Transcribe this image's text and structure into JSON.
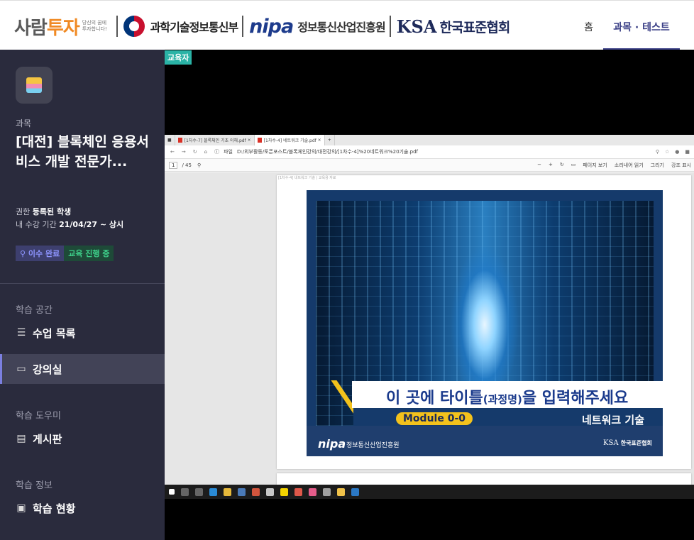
{
  "header": {
    "logo_saram_a": "사람",
    "logo_saram_b": "투자",
    "logo_saram_sub": "당신의 꿈에 투자합니다!",
    "msit": "과학기술정보통신부",
    "nipa_mark": "nipa",
    "nipa_text": "정보통신산업진흥원",
    "ksa_mark": "KSA",
    "ksa_text": "한국표준협회",
    "nav": {
      "home": "홈",
      "courses": "과목 · 테스트"
    }
  },
  "sidebar": {
    "kicker": "과목",
    "course_title": "[대전] 블록체인 응용서비스 개발 전문가...",
    "role_label": "권한",
    "role_value": "등록된 학생",
    "period_label": "내 수강 기간",
    "period_value": "21/04/27 ~ 상시",
    "badge_done": "이수 완료",
    "badge_progress": "교육 진행 중",
    "sections": [
      {
        "title": "학습 공간",
        "items": [
          {
            "label": "수업 목록",
            "icon": "list-icon"
          },
          {
            "label": "강의실",
            "icon": "monitor-icon",
            "active": true
          }
        ]
      },
      {
        "title": "학습 도우미",
        "items": [
          {
            "label": "게시판",
            "icon": "clipboard-icon"
          }
        ]
      },
      {
        "title": "학습 정보",
        "items": [
          {
            "label": "학습 현황",
            "icon": "presentation-icon"
          }
        ]
      }
    ]
  },
  "content": {
    "instructor_tag": "교육자",
    "browser": {
      "tabs": [
        "[1차수-7] 블록체인 기초 이해.pdf",
        "[1차수-4] 네트워크 기술.pdf"
      ],
      "url_label": "파일",
      "url": "D:/외부활동/토픈포스트/블록체인강의/대전강의/[1차수-4]%20네트워크%20기술.pdf",
      "page_num": "1",
      "page_total": "/ 45",
      "toolbar_right": [
        "페이지 보기",
        "소리내어 읽기",
        "그리기",
        "강조 표시"
      ],
      "page_header": "[1차수-4] 네트워크 기술  | 교육용 자료",
      "slide_title": "이 곳에 타이틀",
      "slide_title_small": "(과정명)",
      "slide_title_end": "을 입력해주세요",
      "module": "Module 0-0",
      "slide_subtitle": "네트워크 기술",
      "slide_nipa": "nipa",
      "slide_nipa_text": "정보통신산업진흥원",
      "slide_ksa": "KSA",
      "slide_ksa_text": "한국표준협회"
    }
  }
}
